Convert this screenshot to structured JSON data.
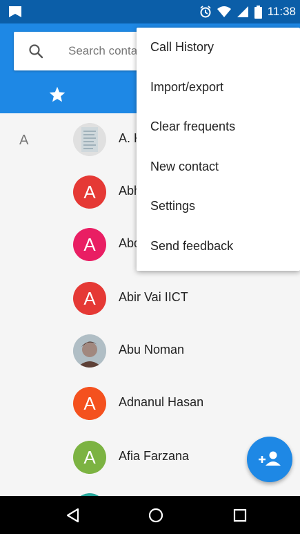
{
  "status_bar": {
    "time": "11:38"
  },
  "search": {
    "placeholder": "Search contacts"
  },
  "tabs": {
    "favorites_icon": "star-icon"
  },
  "contacts": {
    "section_letter": "A",
    "rows": [
      {
        "name": "A. K",
        "initial": "",
        "color": "#dcdcdc"
      },
      {
        "name": "Abhi",
        "initial": "A",
        "color": "#e53935"
      },
      {
        "name": "Abdul",
        "initial": "A",
        "color": "#e91e63"
      },
      {
        "name": "Abir Vai IICT",
        "initial": "A",
        "color": "#e53935"
      },
      {
        "name": "Abu Noman",
        "initial": "",
        "color": "#8d6e63"
      },
      {
        "name": "Adnanul Hasan",
        "initial": "A",
        "color": "#f4511e"
      },
      {
        "name": "Afia Farzana",
        "initial": "A",
        "color": "#7cb342"
      }
    ]
  },
  "menu": {
    "items": [
      "Call History",
      "Import/export",
      "Clear frequents",
      "New contact",
      "Settings",
      "Send feedback"
    ]
  },
  "fab": {
    "icon": "add-contact-icon"
  },
  "nav": {
    "back_icon": "back-icon",
    "home_icon": "home-icon",
    "recents_icon": "recents-icon"
  },
  "colors": {
    "primary": "#1e88e5",
    "status_bar": "#0b5ea8"
  }
}
